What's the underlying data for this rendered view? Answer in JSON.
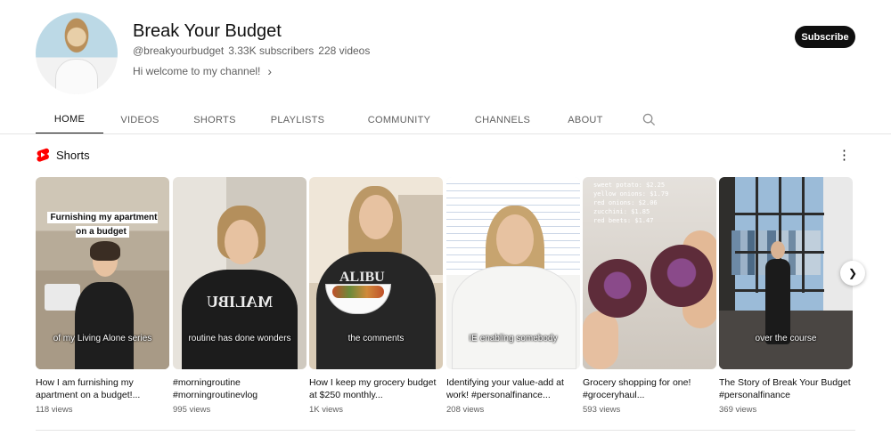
{
  "channel": {
    "name": "Break Your Budget",
    "handle": "@breakyourbudget",
    "subscribers": "3.33K subscribers",
    "videos": "228 videos",
    "description": "Hi welcome to my channel!",
    "subscribe_label": "Subscribe"
  },
  "tabs": [
    {
      "label": "HOME",
      "active": true
    },
    {
      "label": "VIDEOS"
    },
    {
      "label": "SHORTS"
    },
    {
      "label": "PLAYLISTS"
    },
    {
      "label": "COMMUNITY"
    },
    {
      "label": "CHANNELS"
    },
    {
      "label": "ABOUT"
    }
  ],
  "shorts_section": {
    "title": "Shorts",
    "shorts_color": "#ff0000",
    "items": [
      {
        "overlay_title": "Furnishing my apartment on a budget",
        "caption": "of my Living Alone series",
        "title": "How I am furnishing my apartment on a budget!...",
        "views": "118 views"
      },
      {
        "overlay_title": "",
        "caption": "routine has done wonders",
        "title": "#morningroutine #morningroutinevlog",
        "views": "995 views"
      },
      {
        "overlay_title": "",
        "caption": "the comments",
        "title": "How I keep my grocery budget at $250 monthly...",
        "views": "1K views"
      },
      {
        "overlay_title": "",
        "caption": "IE enabling somebody",
        "title": "Identifying your value-add at work! #personalfinance...",
        "views": "208 views"
      },
      {
        "overlay_title": "",
        "caption": "",
        "list_lines": [
          "sweet potato: $2.25",
          "yellow onions: $1.79",
          "red onions: $2.06",
          "zucchini: $1.85",
          "red beets: $1.47"
        ],
        "title": "Grocery shopping for one! #groceryhaul...",
        "views": "593 views"
      },
      {
        "overlay_title": "",
        "caption": "over the course",
        "title": "The Story of Break Your Budget #personalfinance",
        "views": "369 views"
      }
    ]
  },
  "icons": {
    "search": "search-icon",
    "more": "more-vert-icon",
    "next": "chevron-right-icon",
    "shorts": "shorts-logo-icon"
  }
}
